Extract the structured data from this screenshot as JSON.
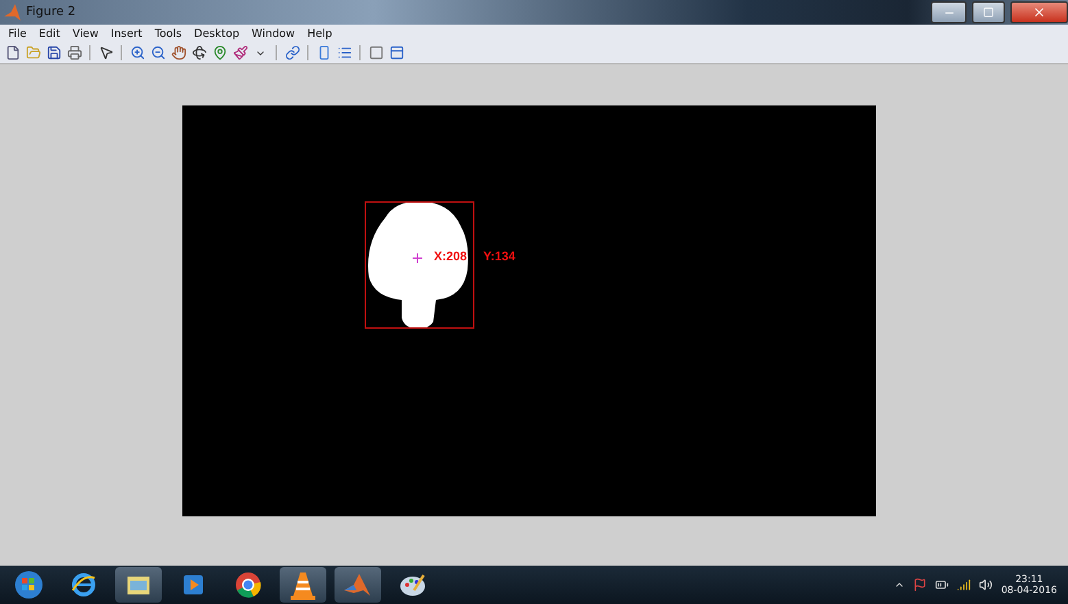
{
  "window": {
    "title": "Figure 2"
  },
  "menu": [
    "File",
    "Edit",
    "View",
    "Insert",
    "Tools",
    "Desktop",
    "Window",
    "Help"
  ],
  "toolbar": [
    {
      "kind": "new"
    },
    {
      "kind": "open"
    },
    {
      "kind": "save"
    },
    {
      "kind": "print"
    },
    {
      "kind": "sep"
    },
    {
      "kind": "pointer"
    },
    {
      "kind": "sep"
    },
    {
      "kind": "zoomin"
    },
    {
      "kind": "zoomout"
    },
    {
      "kind": "pan"
    },
    {
      "kind": "rotate"
    },
    {
      "kind": "cursor"
    },
    {
      "kind": "brush"
    },
    {
      "kind": "caret"
    },
    {
      "kind": "sep"
    },
    {
      "kind": "link"
    },
    {
      "kind": "sep"
    },
    {
      "kind": "colorbar"
    },
    {
      "kind": "legend"
    },
    {
      "kind": "sep"
    },
    {
      "kind": "hide"
    },
    {
      "kind": "show"
    }
  ],
  "annotations": [
    {
      "text": "X:208"
    },
    {
      "text": "Y:134"
    }
  ],
  "taskbar": {
    "apps": [
      {
        "kind": "start",
        "open": false
      },
      {
        "kind": "browser",
        "open": false
      },
      {
        "kind": "folder",
        "open": true
      },
      {
        "kind": "media",
        "open": false
      },
      {
        "kind": "chrome",
        "open": false
      },
      {
        "kind": "cone",
        "open": true
      },
      {
        "kind": "matlab",
        "open": true
      },
      {
        "kind": "paint",
        "open": false
      }
    ],
    "time": "23:11",
    "date": "08-04-2016"
  }
}
